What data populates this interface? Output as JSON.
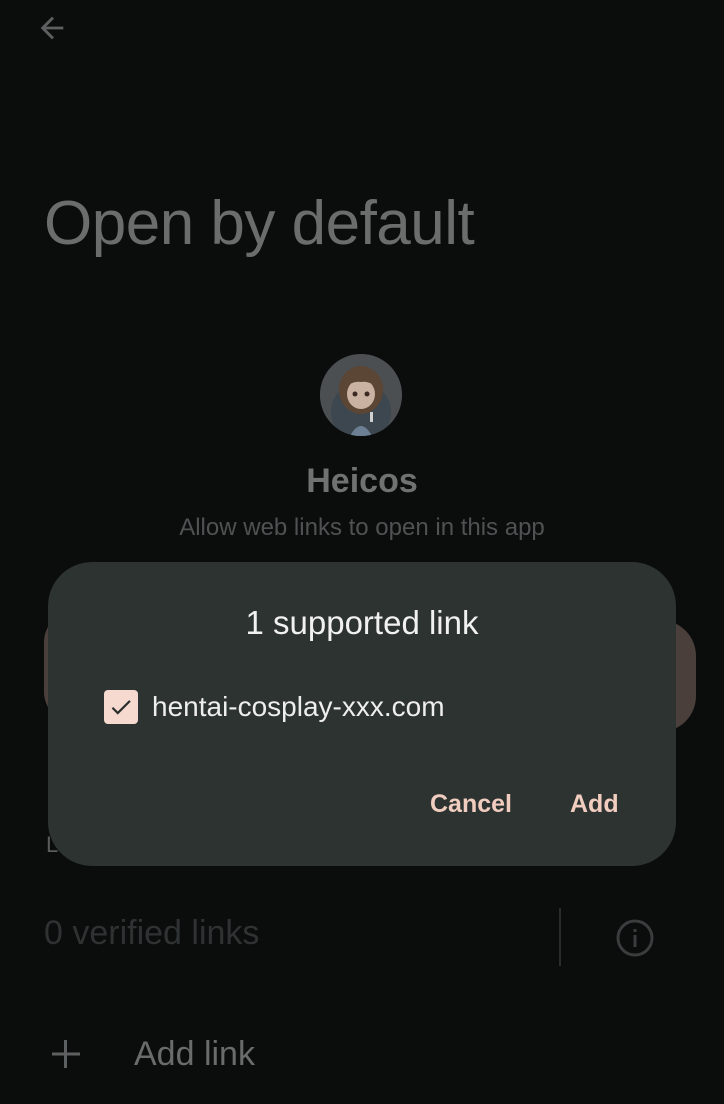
{
  "header": {
    "back_icon": "arrow-left-icon"
  },
  "page": {
    "title": "Open by default"
  },
  "app": {
    "name": "Heicos",
    "subtitle": "Allow web links to open in this app",
    "avatar_icon": "app-avatar-image"
  },
  "links_section": {
    "label_partial": "L",
    "verified_text": "0 verified links",
    "info_icon": "info-icon",
    "add_link_label": "Add link",
    "add_icon": "plus-icon"
  },
  "dialog": {
    "title": "1 supported link",
    "items": [
      {
        "label": "hentai-cosplay-xxx.com",
        "checked": true
      }
    ],
    "cancel_label": "Cancel",
    "add_label": "Add"
  },
  "colors": {
    "background": "#0b0d0d",
    "dialog_bg": "#2c3331",
    "accent": "#f1cdbf",
    "checkbox": "#f6d9cf"
  }
}
